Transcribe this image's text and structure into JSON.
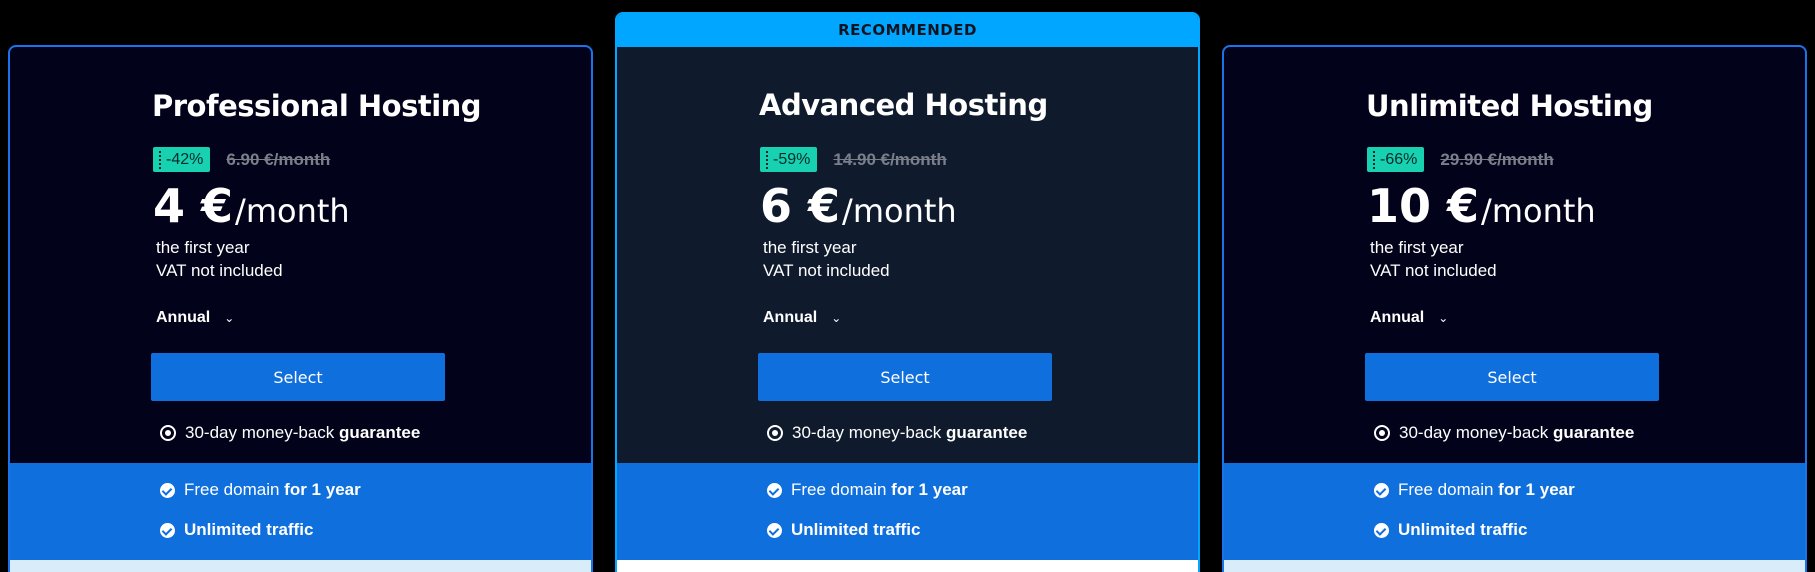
{
  "plans": [
    {
      "name": "Professional Hosting",
      "discount": "-42%",
      "old_price": "6.90 €/month",
      "price": "4 €",
      "price_unit": "/month",
      "note_1": "the first year",
      "note_2": "VAT not included",
      "period": "Annual",
      "select_label": "Select",
      "guarantee_text": "30-day money-back",
      "guarantee_bold": "guarantee",
      "feature_1_text": "Free domain",
      "feature_1_bold": "for 1 year",
      "feature_2_bold": "Unlimited traffic"
    },
    {
      "ribbon": "RECOMMENDED",
      "name": "Advanced Hosting",
      "discount": "-59%",
      "old_price": "14.90 €/month",
      "price": "6 €",
      "price_unit": "/month",
      "note_1": "the first year",
      "note_2": "VAT not included",
      "period": "Annual",
      "select_label": "Select",
      "guarantee_text": "30-day money-back",
      "guarantee_bold": "guarantee",
      "feature_1_text": "Free domain",
      "feature_1_bold": "for 1 year",
      "feature_2_bold": "Unlimited traffic"
    },
    {
      "name": "Unlimited Hosting",
      "discount": "-66%",
      "old_price": "29.90 €/month",
      "price": "10 €",
      "price_unit": "/month",
      "note_1": "the first year",
      "note_2": "VAT not included",
      "period": "Annual",
      "select_label": "Select",
      "guarantee_text": "30-day money-back",
      "guarantee_bold": "guarantee",
      "feature_1_text": "Free domain",
      "feature_1_bold": "for 1 year",
      "feature_2_bold": "Unlimited traffic"
    }
  ],
  "icons": {
    "period_toggle": "chevron-down-icon",
    "guarantee": "medal-icon",
    "feature": "check-badge-icon"
  },
  "colors": {
    "background": "#000000",
    "card_border": "#1a73e8",
    "recommended_accent": "#00a6ff",
    "button": "#0f6fdd",
    "discount_badge": "#17d1b0"
  }
}
